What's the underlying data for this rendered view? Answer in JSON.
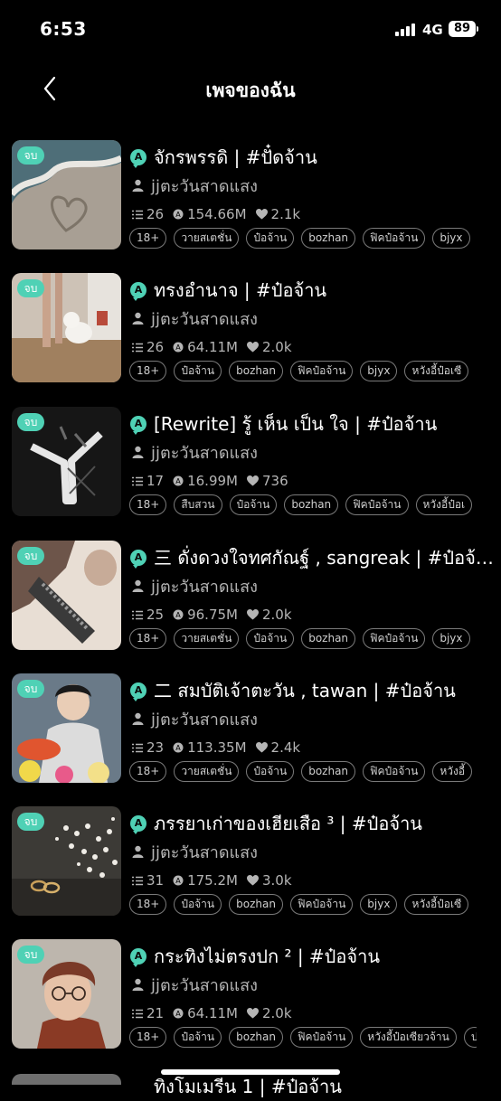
{
  "status_bar": {
    "time": "6:53",
    "network": "4G",
    "battery": "89"
  },
  "nav": {
    "title": "เพจของฉัน"
  },
  "stories": [
    {
      "badge": "จบ",
      "title": "จักรพรรดิ | #ปั๋ดจ้าน",
      "author": "jjตะวันสาดแสง",
      "chapters": "26",
      "reads": "154.66M",
      "likes": "2.1k",
      "tags": [
        "18+",
        "วายสเตชั่น",
        "ป๋อจ้าน",
        "bozhan",
        "ฟิคป๋อจ้าน",
        "bjyx"
      ]
    },
    {
      "badge": "จบ",
      "title": "ทรงอำนาจ | #ป๋อจ้าน",
      "author": "jjตะวันสาดแสง",
      "chapters": "26",
      "reads": "64.11M",
      "likes": "2.0k",
      "tags": [
        "18+",
        "ป๋อจ้าน",
        "bozhan",
        "ฟิคป๋อจ้าน",
        "bjyx",
        "หวังอี้ป๋อเซี"
      ]
    },
    {
      "badge": "จบ",
      "title": "[Rewrite] รู้ เห็น เป็น ใจ | #ป๋อจ้าน",
      "author": "jjตะวันสาดแสง",
      "chapters": "17",
      "reads": "16.99M",
      "likes": "736",
      "tags": [
        "18+",
        "สืบสวน",
        "ป๋อจ้าน",
        "bozhan",
        "ฟิคป๋อจ้าน",
        "หวังอี้ป๋อเ"
      ]
    },
    {
      "badge": "จบ",
      "title": "三 ดั่งดวงใจทศกัณฐ์ , sangreak | #ป๋อจ้าน",
      "author": "jjตะวันสาดแสง",
      "chapters": "25",
      "reads": "96.75M",
      "likes": "2.0k",
      "tags": [
        "18+",
        "วายสเตชั่น",
        "ป๋อจ้าน",
        "bozhan",
        "ฟิคป๋อจ้าน",
        "bjyx"
      ]
    },
    {
      "badge": "จบ",
      "title": "二 สมบัติเจ้าตะวัน , tawan | #ป๋อจ้าน",
      "author": "jjตะวันสาดแสง",
      "chapters": "23",
      "reads": "113.35M",
      "likes": "2.4k",
      "tags": [
        "18+",
        "วายสเตชั่น",
        "ป๋อจ้าน",
        "bozhan",
        "ฟิคป๋อจ้าน",
        "หวังอี้"
      ]
    },
    {
      "badge": "จบ",
      "title": "ภรรยาเก่าของเฮียเสือ ³ | #ป๋อจ้าน",
      "author": "jjตะวันสาดแสง",
      "chapters": "31",
      "reads": "175.2M",
      "likes": "3.0k",
      "tags": [
        "18+",
        "ป๋อจ้าน",
        "bozhan",
        "ฟิคป๋อจ้าน",
        "bjyx",
        "หวังอี้ป๋อเซี"
      ]
    },
    {
      "badge": "จบ",
      "title": "กระทิงไม่ตรงปก ² | #ป๋อจ้าน",
      "author": "jjตะวันสาดแสง",
      "chapters": "21",
      "reads": "64.11M",
      "likes": "2.0k",
      "tags": [
        "18+",
        "ป๋อจ้าน",
        "bozhan",
        "ฟิคป๋อจ้าน",
        "หวังอี้ป๋อเซียวจ้าน",
        "ป"
      ]
    }
  ],
  "peek": {
    "title": "ทิงโมเมรีน 1 | #ป๋อจ้าน"
  },
  "colors": {
    "accent": "#4fd1b5",
    "background": "#000000"
  }
}
